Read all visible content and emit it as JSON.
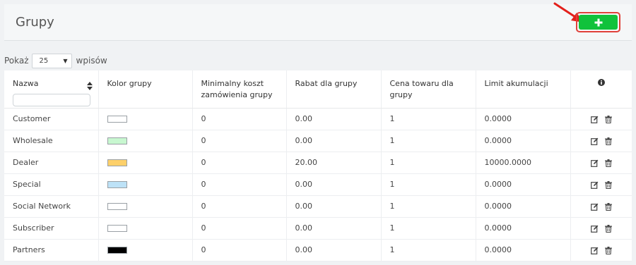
{
  "header": {
    "title": "Grupy",
    "add_button_icon": "plus-icon",
    "accent": "#10c23b",
    "highlight": "#e0413a"
  },
  "length": {
    "prefix": "Pokaż",
    "selected": "25",
    "suffix": "wpisów"
  },
  "table": {
    "headers": {
      "name": "Nazwa",
      "color": "Kolor grupy",
      "min_order": "Minimalny koszt zamówienia grupy",
      "discount": "Rabat dla grupy",
      "price": "Cena towaru dla grupy",
      "limit": "Limit akumulacji",
      "info_icon": "info-icon"
    },
    "rows": [
      {
        "name": "Customer",
        "color": "#ffffff",
        "min_order": "0",
        "discount": "0.00",
        "price": "1",
        "limit": "0.0000"
      },
      {
        "name": "Wholesale",
        "color": "#c8f7d0",
        "min_order": "0",
        "discount": "0.00",
        "price": "1",
        "limit": "0.0000"
      },
      {
        "name": "Dealer",
        "color": "#fdd06a",
        "min_order": "0",
        "discount": "20.00",
        "price": "1",
        "limit": "10000.0000"
      },
      {
        "name": "Special",
        "color": "#bde2f7",
        "min_order": "0",
        "discount": "0.00",
        "price": "1",
        "limit": "0.0000"
      },
      {
        "name": "Social Network",
        "color": "#ffffff",
        "min_order": "0",
        "discount": "0.00",
        "price": "1",
        "limit": "0.0000"
      },
      {
        "name": "Subscriber",
        "color": "#ffffff",
        "min_order": "0",
        "discount": "0.00",
        "price": "1",
        "limit": "0.0000"
      },
      {
        "name": "Partners",
        "color": "#000000",
        "min_order": "0",
        "discount": "0.00",
        "price": "1",
        "limit": "0.0000"
      }
    ]
  }
}
